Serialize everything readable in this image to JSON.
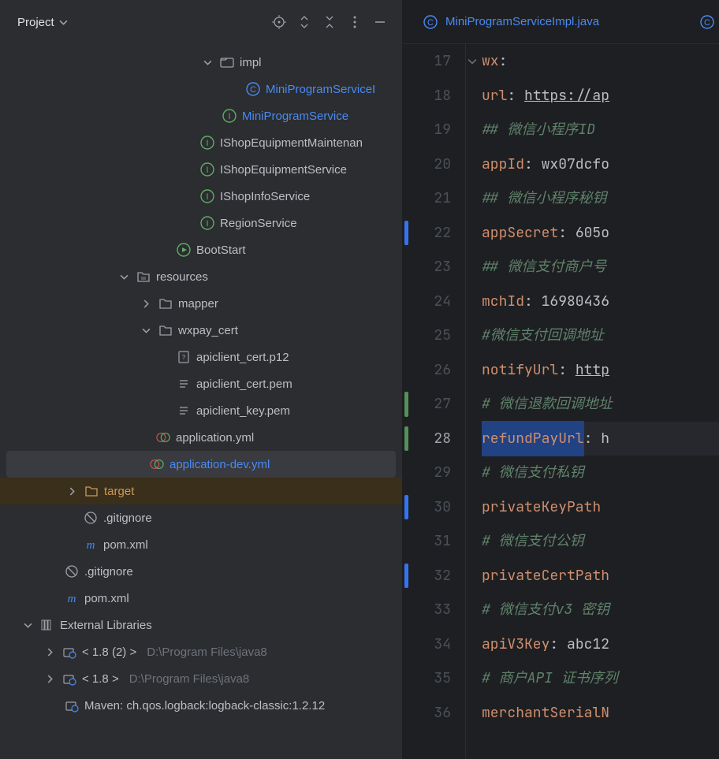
{
  "header": {
    "title": "Project"
  },
  "tree": {
    "items": [
      {
        "indent": 254,
        "chev": "down",
        "icon": "folder",
        "label": "impl",
        "cls": ""
      },
      {
        "indent": 312,
        "chev": "",
        "icon": "class-c",
        "label": "MiniProgramServiceI",
        "cls": "blue"
      },
      {
        "indent": 282,
        "chev": "",
        "icon": "interface-i",
        "label": "MiniProgramService",
        "cls": "blue"
      },
      {
        "indent": 254,
        "chev": "",
        "icon": "interface-i",
        "label": "IShopEquipmentMaintenan",
        "cls": ""
      },
      {
        "indent": 254,
        "chev": "",
        "icon": "interface-i",
        "label": "IShopEquipmentService",
        "cls": ""
      },
      {
        "indent": 254,
        "chev": "",
        "icon": "interface-i",
        "label": "IShopInfoService",
        "cls": ""
      },
      {
        "indent": 254,
        "chev": "",
        "icon": "interface-i",
        "label": "RegionService",
        "cls": ""
      },
      {
        "indent": 224,
        "chev": "",
        "icon": "class-play",
        "label": "BootStart",
        "cls": ""
      },
      {
        "indent": 148,
        "chev": "down",
        "icon": "res-folder",
        "label": "resources",
        "cls": ""
      },
      {
        "indent": 176,
        "chev": "right",
        "icon": "folder-plain",
        "label": "mapper",
        "cls": ""
      },
      {
        "indent": 176,
        "chev": "down",
        "icon": "folder-plain",
        "label": "wxpay_cert",
        "cls": ""
      },
      {
        "indent": 224,
        "chev": "",
        "icon": "file-cert",
        "label": "apiclient_cert.p12",
        "cls": ""
      },
      {
        "indent": 224,
        "chev": "",
        "icon": "file-text",
        "label": "apiclient_cert.pem",
        "cls": ""
      },
      {
        "indent": 224,
        "chev": "",
        "icon": "file-text",
        "label": "apiclient_key.pem",
        "cls": ""
      },
      {
        "indent": 198,
        "chev": "",
        "icon": "yml",
        "label": "application.yml",
        "cls": ""
      },
      {
        "indent": 190,
        "chev": "",
        "icon": "yml",
        "label": "application-dev.yml",
        "cls": "blue",
        "selected": true
      },
      {
        "indent": 82,
        "chev": "right",
        "icon": "folder-target",
        "label": "target",
        "cls": "orange",
        "target": true
      },
      {
        "indent": 106,
        "chev": "",
        "icon": "gitignore",
        "label": ".gitignore",
        "cls": ""
      },
      {
        "indent": 106,
        "chev": "",
        "icon": "maven-m",
        "label": "pom.xml",
        "cls": ""
      },
      {
        "indent": 82,
        "chev": "",
        "icon": "gitignore",
        "label": ".gitignore",
        "cls": ""
      },
      {
        "indent": 82,
        "chev": "",
        "icon": "maven-m",
        "label": "pom.xml",
        "cls": ""
      },
      {
        "indent": 26,
        "chev": "down",
        "icon": "lib",
        "label": "External Libraries",
        "cls": ""
      },
      {
        "indent": 54,
        "chev": "right",
        "icon": "lib-jar",
        "label": "< 1.8 (2) >",
        "extra": "D:\\Program Files\\java8",
        "cls": ""
      },
      {
        "indent": 54,
        "chev": "right",
        "icon": "lib-jar",
        "label": "< 1.8 >",
        "extra": "D:\\Program Files\\java8",
        "cls": ""
      },
      {
        "indent": 82,
        "chev": "",
        "icon": "lib-jar",
        "label": "Maven: ch.qos.logback:logback-classic:1.2.12",
        "cls": ""
      }
    ]
  },
  "tab": {
    "label": "MiniProgramServiceImpl.java",
    "icon": "class-c"
  },
  "code": {
    "startLine": 17,
    "currentLine": 28,
    "lines": [
      {
        "n": 17,
        "indent": 0,
        "type": "key-only",
        "key": "wx",
        "fold": true
      },
      {
        "n": 18,
        "indent": 1,
        "type": "kv-url",
        "key": "url",
        "val": "https://ap"
      },
      {
        "n": 19,
        "indent": 1,
        "type": "comment",
        "text": "## 微信小程序ID"
      },
      {
        "n": 20,
        "indent": 1,
        "type": "kv",
        "key": "appId",
        "val": "wx07dcfo"
      },
      {
        "n": 21,
        "indent": 1,
        "type": "comment",
        "text": "## 微信小程序秘钥"
      },
      {
        "n": 22,
        "indent": 1,
        "type": "kv",
        "key": "appSecret",
        "val": "605o",
        "stripe": "blue"
      },
      {
        "n": 23,
        "indent": 1,
        "type": "comment",
        "text": "## 微信支付商户号"
      },
      {
        "n": 24,
        "indent": 1,
        "type": "kv",
        "key": "mchId",
        "val": "16980436"
      },
      {
        "n": 25,
        "indent": 1,
        "type": "comment",
        "text": "#微信支付回调地址"
      },
      {
        "n": 26,
        "indent": 1,
        "type": "kv-url",
        "key": "notifyUrl",
        "val": "http"
      },
      {
        "n": 27,
        "indent": 1,
        "type": "comment",
        "text": "# 微信退款回调地址",
        "stripe": "green"
      },
      {
        "n": 28,
        "indent": 1,
        "type": "kv-sel",
        "key": "refundPayUrl",
        "val": "h",
        "stripe": "green",
        "current": true
      },
      {
        "n": 29,
        "indent": 1,
        "type": "comment",
        "text": "# 微信支付私钥"
      },
      {
        "n": 30,
        "indent": 1,
        "type": "key-only",
        "key": "privateKeyPath",
        "stripe": "blue"
      },
      {
        "n": 31,
        "indent": 1,
        "type": "comment",
        "text": "# 微信支付公钥"
      },
      {
        "n": 32,
        "indent": 1,
        "type": "key-only",
        "key": "privateCertPath",
        "stripe": "blue"
      },
      {
        "n": 33,
        "indent": 1,
        "type": "comment-mixed",
        "text": "# 微信支付v3 密钥"
      },
      {
        "n": 34,
        "indent": 1,
        "type": "kv",
        "key": "apiV3Key",
        "val": "abc12"
      },
      {
        "n": 35,
        "indent": 1,
        "type": "comment-mixed",
        "text": "# 商户API 证书序列"
      },
      {
        "n": 36,
        "indent": 1,
        "type": "key-only",
        "key": "merchantSerialN"
      }
    ]
  }
}
